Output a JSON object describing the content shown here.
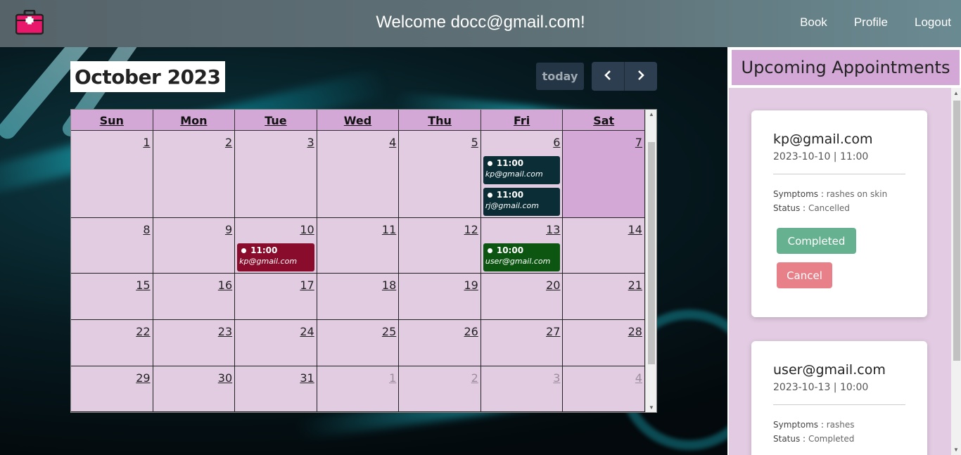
{
  "header": {
    "welcome": "Welcome docc@gmail.com!",
    "logo_icon": "medical-kit-icon",
    "nav": [
      {
        "label": "Book"
      },
      {
        "label": "Profile"
      },
      {
        "label": "Logout"
      }
    ]
  },
  "calendar": {
    "title": "October 2023",
    "today_label": "today",
    "prev_icon": "chevron-left-icon",
    "next_icon": "chevron-right-icon",
    "weekdays": [
      "Sun",
      "Mon",
      "Tue",
      "Wed",
      "Thu",
      "Fri",
      "Sat"
    ],
    "weeks": [
      [
        {
          "day": "1"
        },
        {
          "day": "2"
        },
        {
          "day": "3"
        },
        {
          "day": "4"
        },
        {
          "day": "5"
        },
        {
          "day": "6",
          "events": [
            {
              "time": "11:00",
              "title": "kp@gmail.com",
              "color": "#0b2e36"
            },
            {
              "time": "11:00",
              "title": "rj@gmail.com",
              "color": "#0b2e36"
            }
          ]
        },
        {
          "day": "7",
          "today": true
        }
      ],
      [
        {
          "day": "8"
        },
        {
          "day": "9"
        },
        {
          "day": "10",
          "events": [
            {
              "time": "11:00",
              "title": "kp@gmail.com",
              "color": "#8a0c2c"
            }
          ]
        },
        {
          "day": "11"
        },
        {
          "day": "12"
        },
        {
          "day": "13",
          "events": [
            {
              "time": "10:00",
              "title": "user@gmail.com",
              "color": "#0c5612"
            }
          ]
        },
        {
          "day": "14"
        }
      ],
      [
        {
          "day": "15"
        },
        {
          "day": "16"
        },
        {
          "day": "17"
        },
        {
          "day": "18"
        },
        {
          "day": "19"
        },
        {
          "day": "20"
        },
        {
          "day": "21"
        }
      ],
      [
        {
          "day": "22"
        },
        {
          "day": "23"
        },
        {
          "day": "24"
        },
        {
          "day": "25"
        },
        {
          "day": "26"
        },
        {
          "day": "27"
        },
        {
          "day": "28"
        }
      ],
      [
        {
          "day": "29"
        },
        {
          "day": "30"
        },
        {
          "day": "31"
        },
        {
          "day": "1",
          "other": true
        },
        {
          "day": "2",
          "other": true
        },
        {
          "day": "3",
          "other": true
        },
        {
          "day": "4",
          "other": true
        }
      ]
    ]
  },
  "upcoming": {
    "title": "Upcoming Appointments",
    "cards": [
      {
        "email": "kp@gmail.com",
        "datetime": "2023-10-10 | 11:00",
        "symptoms_label": "Symptoms :",
        "symptoms": "rashes on skin",
        "status_label": "Status :",
        "status": "Cancelled",
        "buttons": [
          "Completed",
          "Cancel"
        ]
      },
      {
        "email": "user@gmail.com",
        "datetime": "2023-10-13 | 10:00",
        "symptoms_label": "Symptoms :",
        "symptoms": "rashes",
        "status_label": "Status :",
        "status": "Completed"
      }
    ]
  },
  "colors": {
    "calendar_cell": "#e2cce2",
    "calendar_header": "#d3a8d6",
    "completed_button": "#66b18f",
    "cancel_button": "#e8808a"
  }
}
